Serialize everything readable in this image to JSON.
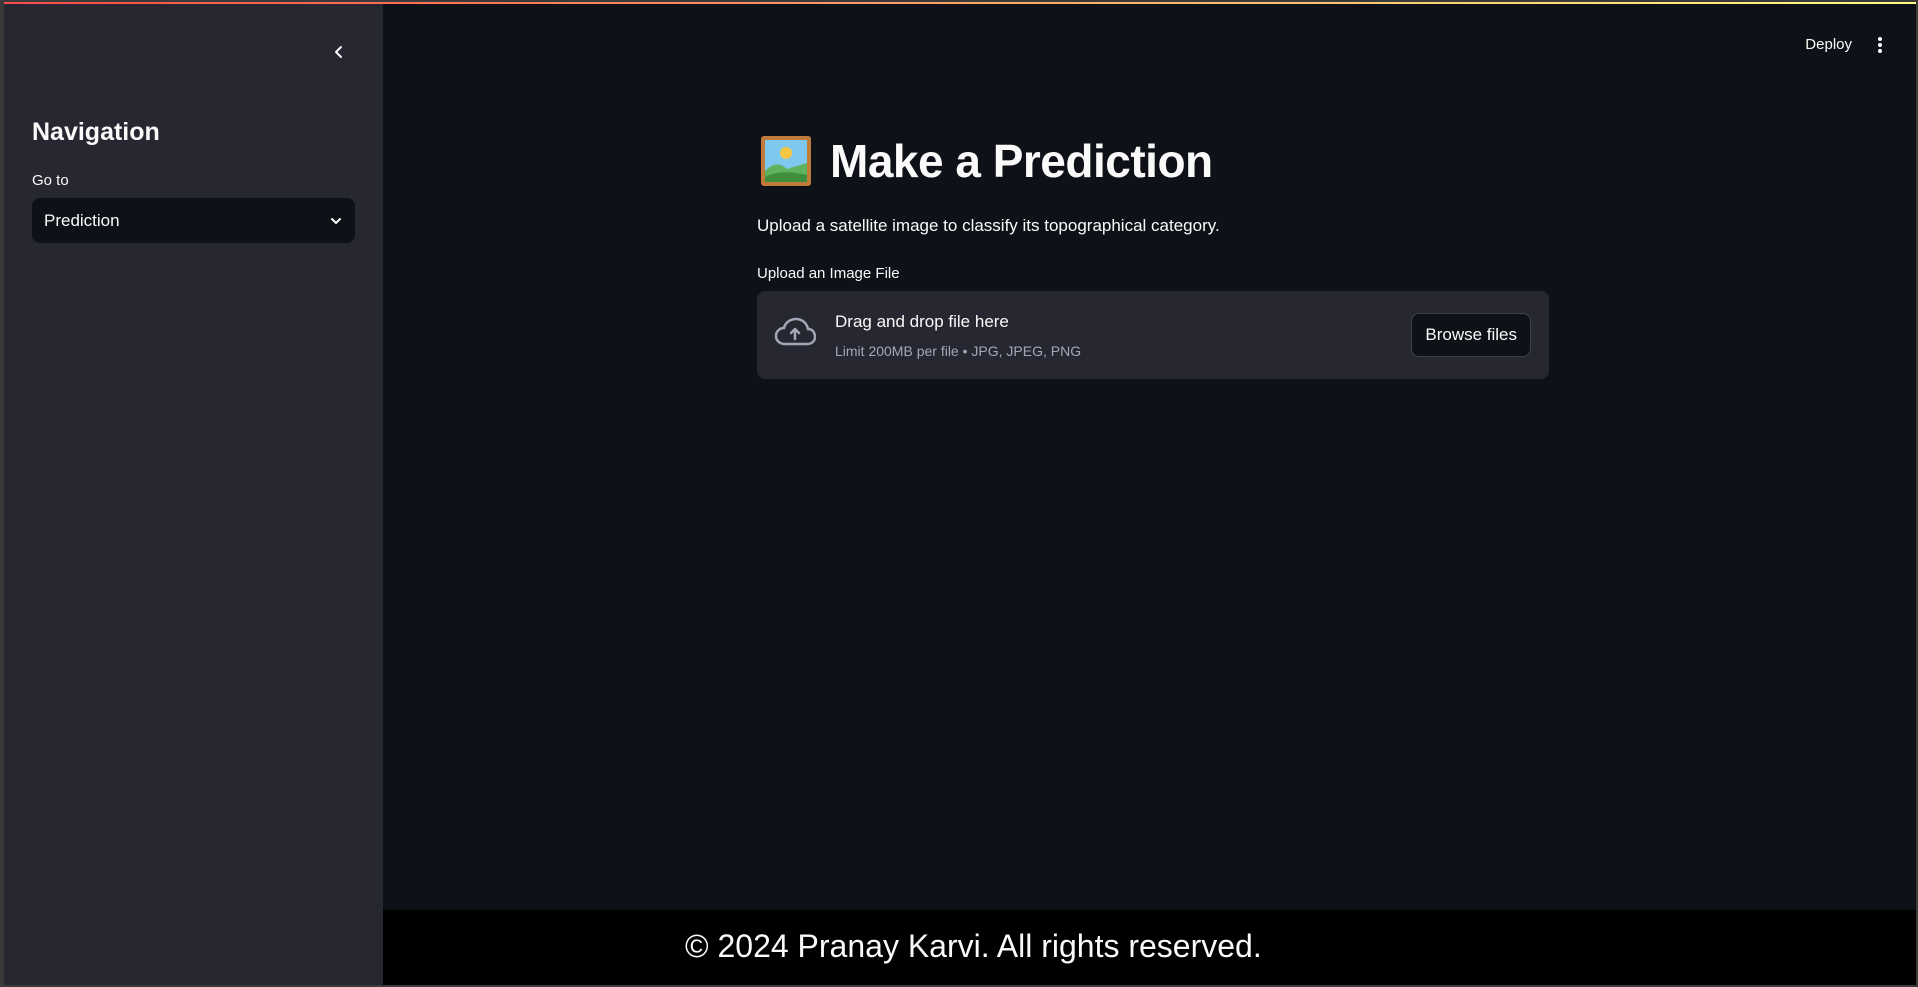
{
  "colors": {
    "background": "#0e1117",
    "sidebar": "#262730",
    "accent_gradient_start": "#ff4b4b",
    "accent_gradient_end": "#fffd80",
    "footer": "#000000",
    "text": "#fafafa",
    "muted_text": "#a3a8b8"
  },
  "sidebar": {
    "collapse_icon": "chevron-left-icon",
    "title": "Navigation",
    "select_label": "Go to",
    "selected_option": "Prediction",
    "select_icon": "chevron-down-icon"
  },
  "header": {
    "deploy_label": "Deploy",
    "menu_icon": "vertical-ellipsis-icon"
  },
  "main": {
    "title_icon": "framed-picture-icon",
    "title": "Make a Prediction",
    "subtitle": "Upload a satellite image to classify its topographical category.",
    "uploader": {
      "label": "Upload an Image File",
      "icon": "cloud-upload-icon",
      "drop_text": "Drag and drop file here",
      "limit_text": "Limit 200MB per file • JPG, JPEG, PNG",
      "browse_label": "Browse files"
    }
  },
  "footer": {
    "text": "© 2024 Pranay Karvi. All rights reserved."
  }
}
